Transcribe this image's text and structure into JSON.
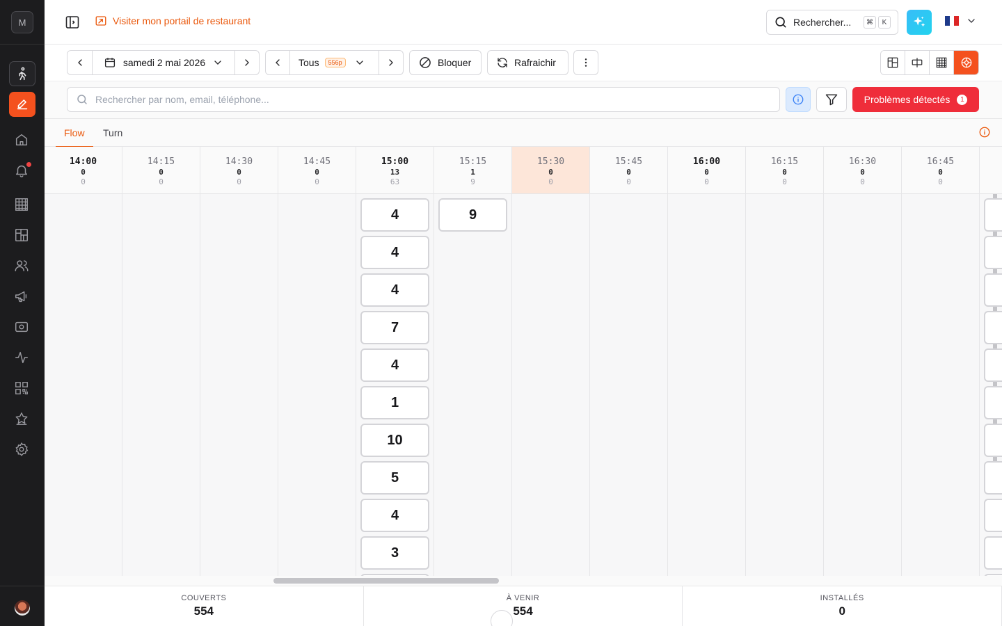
{
  "sidebar": {
    "workspace_initial": "M",
    "items": [
      {
        "name": "walk-in",
        "icon": "walk-icon"
      },
      {
        "name": "reservations",
        "icon": "edit-icon"
      },
      {
        "name": "home",
        "icon": "home-icon"
      },
      {
        "name": "notifications",
        "icon": "bell-icon"
      },
      {
        "name": "calendar",
        "icon": "grid-icon"
      },
      {
        "name": "floorplan",
        "icon": "layout-icon"
      },
      {
        "name": "customers",
        "icon": "users-icon"
      },
      {
        "name": "marketing",
        "icon": "megaphone-icon"
      },
      {
        "name": "payments",
        "icon": "cash-icon"
      },
      {
        "name": "analytics",
        "icon": "activity-icon"
      },
      {
        "name": "qr",
        "icon": "qr-icon"
      },
      {
        "name": "reviews",
        "icon": "star-icon"
      },
      {
        "name": "settings",
        "icon": "gear-icon"
      }
    ]
  },
  "topbar": {
    "portal_link": "Visiter mon portail de restaurant",
    "search_label": "Rechercher...",
    "shortcut_keys": [
      "⌘",
      "K"
    ]
  },
  "toolbar": {
    "date_label": "samedi 2 mai 2026",
    "service_label": "Tous",
    "service_badge": "556p",
    "block_label": "Bloquer",
    "refresh_label": "Rafraichir"
  },
  "filters": {
    "search_placeholder": "Rechercher par nom, email, téléphone...",
    "problems_label": "Problèmes détectés",
    "problems_count": "1"
  },
  "tabs": [
    {
      "label": "Flow",
      "active": true
    },
    {
      "label": "Turn",
      "active": false
    }
  ],
  "slots": [
    {
      "time": "14:00",
      "covers": "0",
      "sub": "0",
      "strong": true,
      "highlight": false,
      "cards": []
    },
    {
      "time": "14:15",
      "covers": "0",
      "sub": "0",
      "strong": false,
      "highlight": false,
      "cards": []
    },
    {
      "time": "14:30",
      "covers": "0",
      "sub": "0",
      "strong": false,
      "highlight": false,
      "cards": []
    },
    {
      "time": "14:45",
      "covers": "0",
      "sub": "0",
      "strong": false,
      "highlight": false,
      "cards": []
    },
    {
      "time": "15:00",
      "covers": "13",
      "sub": "63",
      "strong": true,
      "highlight": false,
      "cards": [
        "4",
        "4",
        "4",
        "7",
        "4",
        "1",
        "10",
        "5",
        "4",
        "3",
        ""
      ]
    },
    {
      "time": "15:15",
      "covers": "1",
      "sub": "9",
      "strong": false,
      "highlight": false,
      "cards": [
        "9"
      ]
    },
    {
      "time": "15:30",
      "covers": "0",
      "sub": "0",
      "strong": false,
      "highlight": true,
      "cards": []
    },
    {
      "time": "15:45",
      "covers": "0",
      "sub": "0",
      "strong": false,
      "highlight": false,
      "cards": []
    },
    {
      "time": "16:00",
      "covers": "0",
      "sub": "0",
      "strong": true,
      "highlight": false,
      "cards": []
    },
    {
      "time": "16:15",
      "covers": "0",
      "sub": "0",
      "strong": false,
      "highlight": false,
      "cards": []
    },
    {
      "time": "16:30",
      "covers": "0",
      "sub": "0",
      "strong": false,
      "highlight": false,
      "cards": []
    },
    {
      "time": "16:45",
      "covers": "0",
      "sub": "0",
      "strong": false,
      "highlight": false,
      "cards": []
    }
  ],
  "footer": {
    "stats": [
      {
        "label": "COUVERTS",
        "value": "554"
      },
      {
        "label": "À VENIR",
        "value": "554"
      },
      {
        "label": "INSTALLÉS",
        "value": "0"
      }
    ]
  },
  "colors": {
    "accent": "#f4511e",
    "danger": "#ef2d3a",
    "highlight_slot": "#fde6d9"
  }
}
